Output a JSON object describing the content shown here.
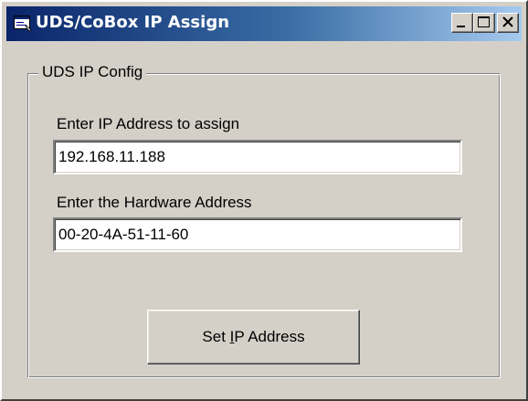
{
  "window": {
    "title": "UDS/CoBox IP Assign",
    "app_icon": "app-window-icon",
    "controls": {
      "minimize_icon": "minimize-icon",
      "maximize_icon": "maximize-icon",
      "close_icon": "close-icon"
    }
  },
  "group": {
    "legend": "UDS IP Config"
  },
  "ip_field": {
    "label": "Enter IP Address to assign",
    "value": "192.168.11.188"
  },
  "hw_field": {
    "label": "Enter the Hardware Address",
    "value": "00-20-4A-51-11-60"
  },
  "set_button": {
    "label_before": "Set ",
    "label_accel": "I",
    "label_after": "P Address"
  },
  "colors": {
    "titlebar_start": "#0a246a",
    "titlebar_end": "#a6caf0",
    "face": "#d4d0c8"
  }
}
